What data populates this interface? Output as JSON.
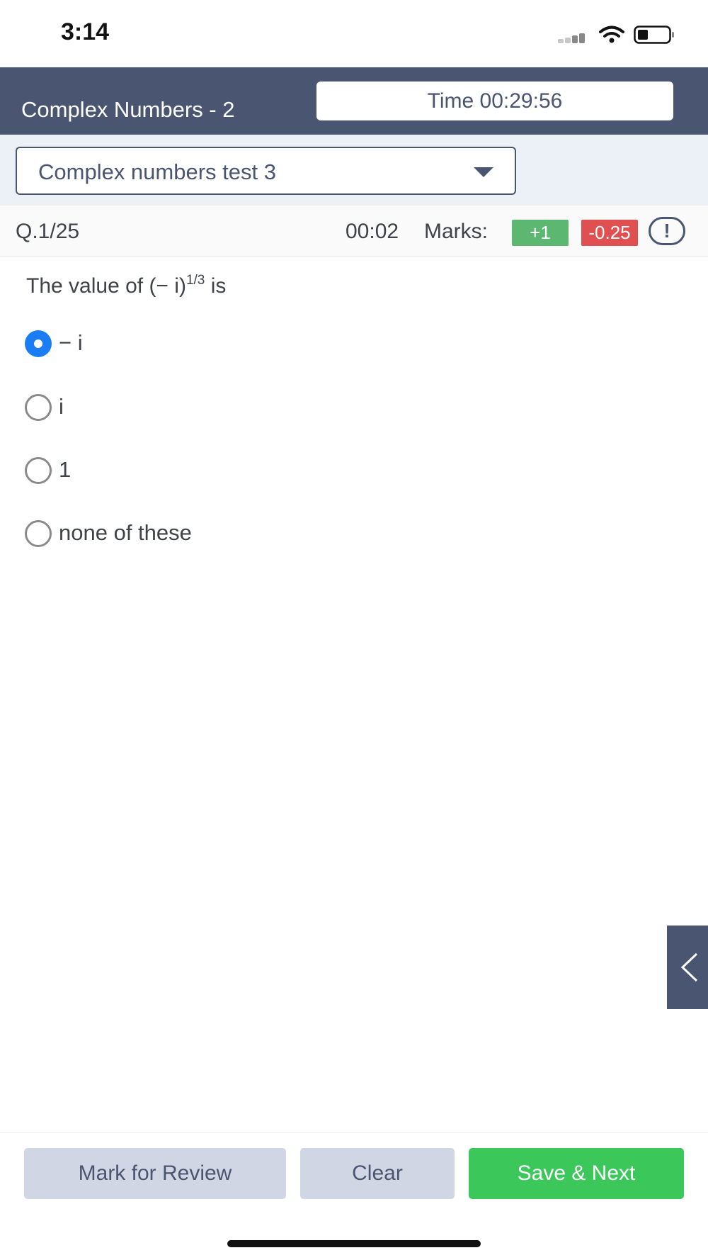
{
  "status_bar": {
    "time": "3:14"
  },
  "header": {
    "title": "Complex Numbers - 2",
    "timer": "Time 00:29:56"
  },
  "test_selector": {
    "selected": "Complex numbers test 3"
  },
  "question_meta": {
    "number": "Q.1/25",
    "elapsed": "00:02",
    "marks_label": "Marks:",
    "positive_marks": "+1",
    "negative_marks": "-0.25",
    "report_icon_glyph": "!"
  },
  "question": {
    "text_prefix": "The value of (− i)",
    "exponent": "1/3",
    "text_suffix": " is"
  },
  "options": [
    {
      "label": "− i",
      "selected": true
    },
    {
      "label": "i",
      "selected": false
    },
    {
      "label": "1",
      "selected": false
    },
    {
      "label": "none of these",
      "selected": false
    }
  ],
  "actions": {
    "mark_review": "Mark for Review",
    "clear": "Clear",
    "save_next": "Save & Next"
  },
  "colors": {
    "header_bg": "#4a5571",
    "selected_radio": "#1a7df4",
    "positive_badge": "#5cb870",
    "negative_badge": "#e05050",
    "save_button": "#3cc75b",
    "secondary_button": "#d0d6e3"
  },
  "icons": [
    "signal-icon",
    "wifi-icon",
    "battery-icon",
    "chevron-down-icon",
    "report-icon",
    "chevron-left-icon"
  ]
}
